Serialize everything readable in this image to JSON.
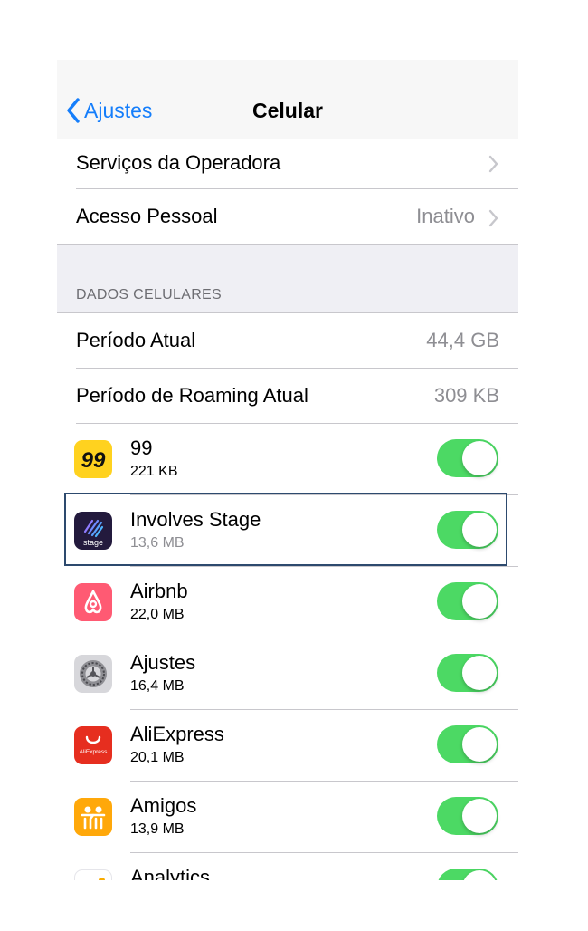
{
  "nav": {
    "back_label": "Ajustes",
    "title": "Celular"
  },
  "rows_top": [
    {
      "label": "Serviços da Operadora",
      "value": ""
    },
    {
      "label": "Acesso Pessoal",
      "value": "Inativo"
    }
  ],
  "section": {
    "header": "DADOS CELULARES"
  },
  "usage": [
    {
      "label": "Período Atual",
      "value": "44,4 GB"
    },
    {
      "label": "Período de Roaming Atual",
      "value": "309 KB"
    }
  ],
  "apps": [
    {
      "name": "99",
      "size": "221 KB",
      "icon": "99-app-icon",
      "enabled": true
    },
    {
      "name": "Involves Stage",
      "size": "13,6 MB",
      "icon": "involves-stage-app-icon",
      "icon_text": "stage",
      "enabled": true
    },
    {
      "name": "Airbnb",
      "size": "22,0 MB",
      "icon": "airbnb-app-icon",
      "enabled": true
    },
    {
      "name": "Ajustes",
      "size": "16,4 MB",
      "icon": "settings-app-icon",
      "enabled": true
    },
    {
      "name": "AliExpress",
      "size": "20,1 MB",
      "icon": "aliexpress-app-icon",
      "icon_text": "AliExpress",
      "enabled": true
    },
    {
      "name": "Amigos",
      "size": "13,9 MB",
      "icon": "find-friends-app-icon",
      "enabled": true
    },
    {
      "name": "Analytics",
      "size": "",
      "icon": "analytics-app-icon",
      "enabled": true
    }
  ],
  "colors": {
    "accent": "#157efb",
    "toggle_on": "#4cd964",
    "highlight_border": "#2d4a6e"
  }
}
